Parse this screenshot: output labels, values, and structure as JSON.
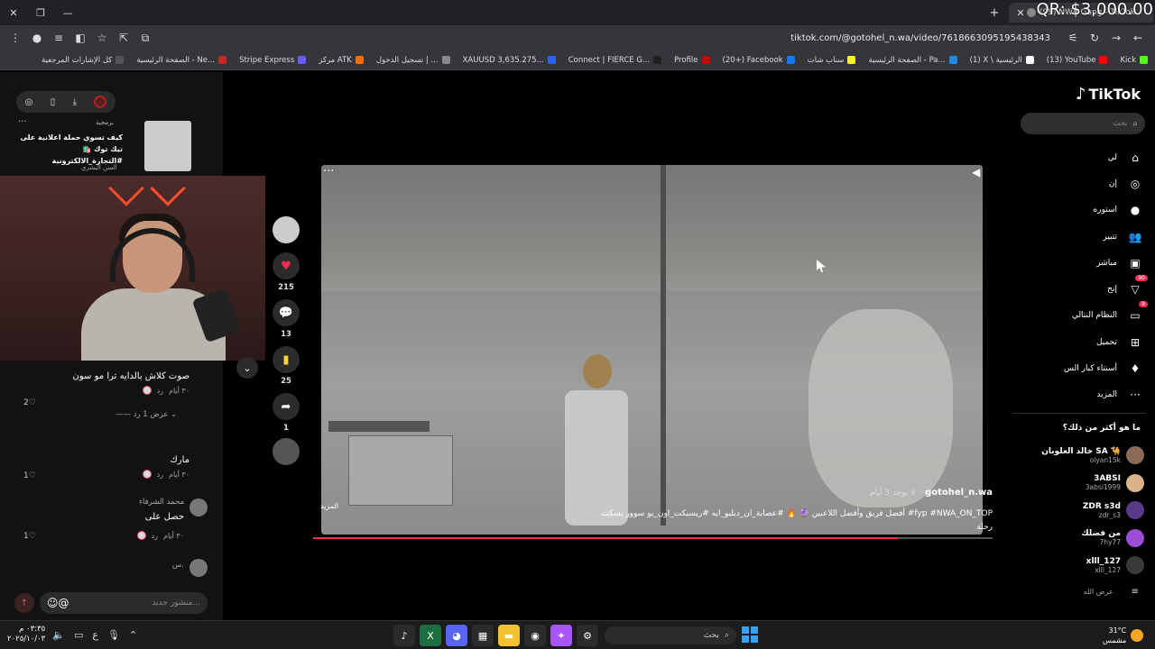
{
  "browser": {
    "tabs": [
      {
        "label": "(99) NWA Gang - TikTok"
      }
    ],
    "overlay_text": "QR: $3,000.00",
    "url": "tiktok.com/@gotohel_n.wa/video/7618663095195438343",
    "bookmarks": [
      {
        "label": "Kick",
        "color": "#53fc18"
      },
      {
        "label": "(13) YouTube",
        "color": "#ff0000"
      },
      {
        "label": "(1) X \\ الرئيسية",
        "color": "#ffffff"
      },
      {
        "label": "الصفحة الرئيسية - Pa...",
        "color": "#1e88e5"
      },
      {
        "label": "سناب شات",
        "color": "#fffc00"
      },
      {
        "label": "(20+) Facebook",
        "color": "#1877f2"
      },
      {
        "label": "Profile",
        "color": "#cc0000"
      },
      {
        "label": "Connect | FIERCE G...",
        "color": "#222222"
      },
      {
        "label": "XAUUSD 3,635.275...",
        "color": "#2962ff"
      },
      {
        "label": "تسجيل الدخول | ...",
        "color": "#888888"
      },
      {
        "label": "مركز ATK",
        "color": "#ff6d00"
      },
      {
        "label": "Stripe Express",
        "color": "#635bff"
      },
      {
        "label": "الصفحة الرئيسية - Ne...",
        "color": "#c62828"
      },
      {
        "label": "كل الإشارات المرجعية",
        "color": "#555555"
      }
    ]
  },
  "left": {
    "ad": {
      "label": "برمجية",
      "title": "كيف تسوي حملة اعلانية على تيك توك 🛍️ #التجارة_الالكترونية",
      "author": "السن البشري"
    },
    "comments": [
      {
        "text": "صوت كلاش بالدايه ترا مو سون",
        "time": "٣٠ أيام",
        "reply": "رد",
        "likes": "2"
      },
      {
        "view_replies": "عرض 1 رد"
      },
      {
        "text": "مارك",
        "time": "٣٠ أيام",
        "reply": "رد",
        "likes": "1"
      },
      {
        "author": "محمد الشرفاء",
        "text": "حصل على",
        "time": "٣٠ أيام",
        "reply": "رد",
        "likes": "1"
      },
      {
        "author": "س."
      }
    ],
    "composer_placeholder": "منشور جديد..."
  },
  "actions": {
    "likes": "215",
    "comments": "13",
    "saves": "25",
    "shares": "1"
  },
  "video": {
    "username": "gotohel_n.wa",
    "time_ago": "لا يوجد 3 أيام",
    "description": "أفضل فريق وأفضل اللاعبين 🔮 🔥 #عصابة_ان_دبليو_ايه #ريسبكت_اون_يو سوور يسكت #fyp #NWA_ON_TOP",
    "description_line2": "رحلة",
    "more_label": "المزيد",
    "progress": 0.86
  },
  "sidebar": {
    "logo": "TikTok",
    "search_placeholder": "بحث",
    "nav": [
      {
        "label": "لي",
        "icon": "home-icon",
        "glyph": "⌂"
      },
      {
        "label": "إن",
        "icon": "compass-icon",
        "glyph": "◎"
      },
      {
        "label": "استوره",
        "icon": "profile-icon",
        "glyph": "●"
      },
      {
        "label": "تتبير",
        "icon": "following-icon",
        "glyph": "👥"
      },
      {
        "label": "مباشر",
        "icon": "live-icon",
        "glyph": "▣"
      },
      {
        "label": "إنح",
        "icon": "inbox-icon",
        "glyph": "▽",
        "badge": "90"
      },
      {
        "label": "النظام النتالي",
        "icon": "messages-icon",
        "glyph": "▭",
        "badge": "9"
      },
      {
        "label": "تحميل",
        "icon": "upload-icon",
        "glyph": "⊞"
      },
      {
        "label": "أسنتاء كبار الس",
        "icon": "coin-icon",
        "glyph": "♦"
      },
      {
        "label": "المزيد",
        "icon": "more-icon",
        "glyph": "···"
      }
    ],
    "suggested_title": "ما هو أكثر من ذلك؟",
    "suggested": [
      {
        "name": "خالد العلوبان SA 🐪",
        "user": "olyan15k",
        "color": "#8a6b5a"
      },
      {
        "name": "3ABSI",
        "user": "3absi1999",
        "color": "#d9b48a"
      },
      {
        "name": "ZDR s3d",
        "user": "zdr_s3",
        "color": "#5a3a8a"
      },
      {
        "name": "من فضلك",
        "user": "7hy77",
        "color": "#9b4dd6"
      },
      {
        "name": "xlll_127",
        "user": "xlll_127",
        "color": "#3a3a3a"
      }
    ],
    "see_more": "عرض الله"
  },
  "taskbar": {
    "time": "٠٣:٣٥ م",
    "date": "٢٠٢٥/١٠/٠٣",
    "search_placeholder": "بحث",
    "temp": "31°C",
    "weather": "مشمس"
  }
}
